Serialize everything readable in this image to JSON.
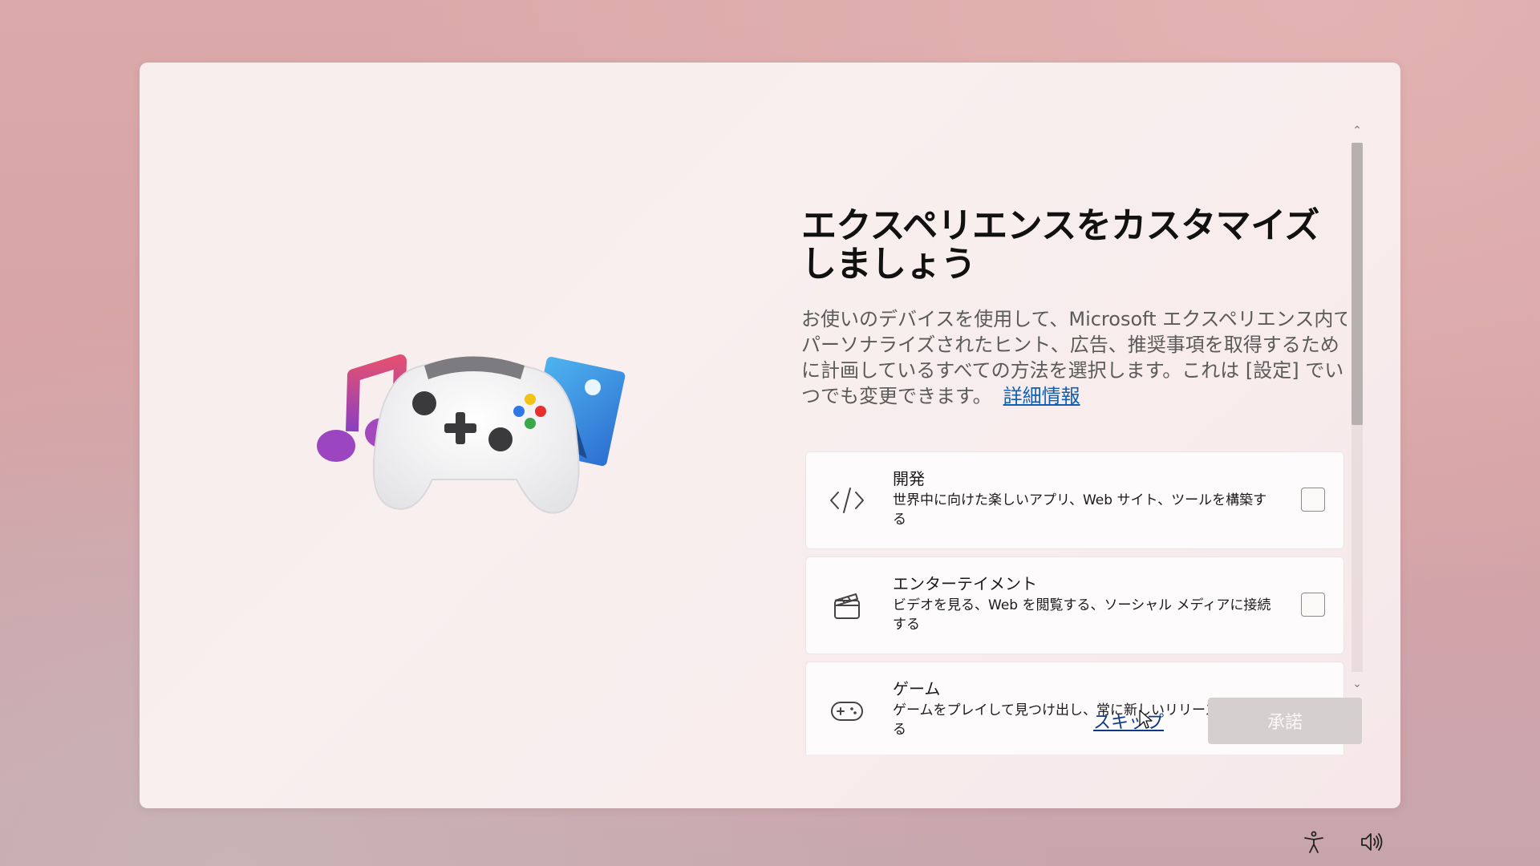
{
  "title": "エクスペリエンスをカスタマイズしましょう",
  "description": "お使いのデバイスを使用して、Microsoft エクスペリエンス内でパーソナライズされたヒント、広告、推奨事項を取得するために計画しているすべての方法を選択します。これは [設定] でいつでも変更できます。",
  "learn_more_label": "詳細情報",
  "options": [
    {
      "icon": "code-icon",
      "name": "開発",
      "description": "世界中に向けた楽しいアプリ、Web サイト、ツールを構築する",
      "checked": false
    },
    {
      "icon": "clapperboard-icon",
      "name": "エンターテイメント",
      "description": "ビデオを見る、Web を閲覧する、ソーシャル メディアに接続する",
      "checked": false
    },
    {
      "icon": "gamepad-icon",
      "name": "ゲーム",
      "description": "ゲームをプレイして見つけ出し、常に新しいリリースを把握する",
      "checked": false
    }
  ],
  "footer": {
    "skip_label": "スキップ",
    "accept_label": "承諾"
  },
  "system_icons": [
    "accessibility-icon",
    "volume-icon"
  ],
  "colors": {
    "link": "#0f5fb3",
    "accept_disabled_bg": "#d5cfd0"
  }
}
